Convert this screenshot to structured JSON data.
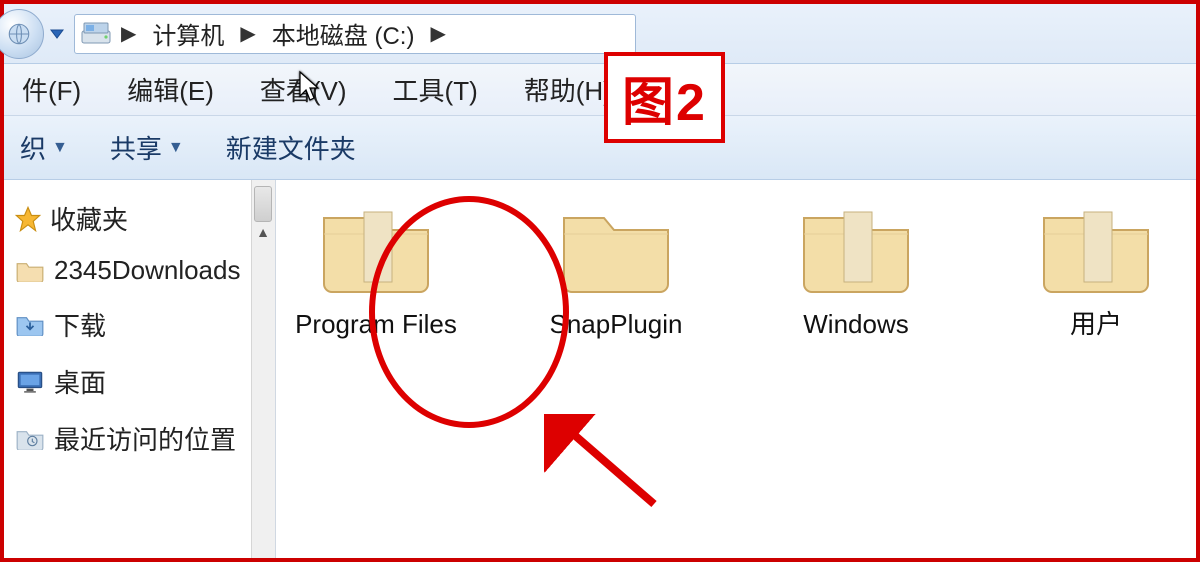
{
  "annotation": {
    "label": "图2"
  },
  "breadcrumb": {
    "segs": [
      "计算机",
      "本地磁盘 (C:)"
    ]
  },
  "menu": {
    "items": [
      "件(F)",
      "编辑(E)",
      "查看(V)",
      "工具(T)",
      "帮助(H)"
    ]
  },
  "toolbar": {
    "items": [
      "织",
      "共享",
      "新建文件夹"
    ],
    "has_dropdown": [
      true,
      true,
      false
    ]
  },
  "sidebar": {
    "heading": "收藏夹",
    "items": [
      "2345Downloads",
      "下载",
      "桌面",
      "最近访问的位置"
    ]
  },
  "folders": [
    "Program Files",
    "SnapPlugin",
    "Windows",
    "用户"
  ],
  "icons": {
    "nav_back": "back-globe",
    "drive": "drive-icon",
    "fav_star": "star-icon"
  }
}
